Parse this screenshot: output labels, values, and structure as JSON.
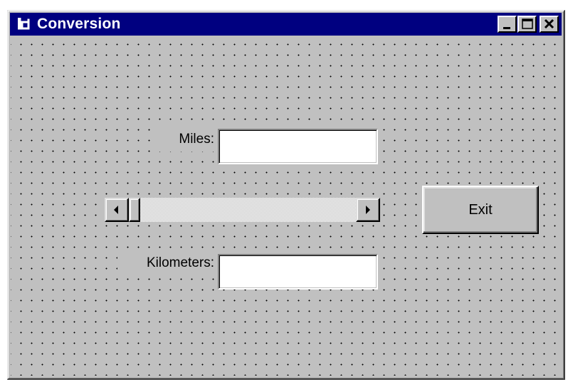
{
  "window": {
    "title": "Conversion",
    "icon": "form-icon",
    "controls": [
      "minimize-icon",
      "maximize-icon",
      "close-icon"
    ]
  },
  "form": {
    "miles_label": "Miles:",
    "miles_value": "",
    "kilometers_label": "Kilometers:",
    "kilometers_value": "",
    "scrollbar": {
      "position": 0
    },
    "exit_label": "Exit"
  },
  "colors": {
    "titlebar": "#000080",
    "face": "#c0c0c0",
    "text_bg": "#ffffff"
  }
}
